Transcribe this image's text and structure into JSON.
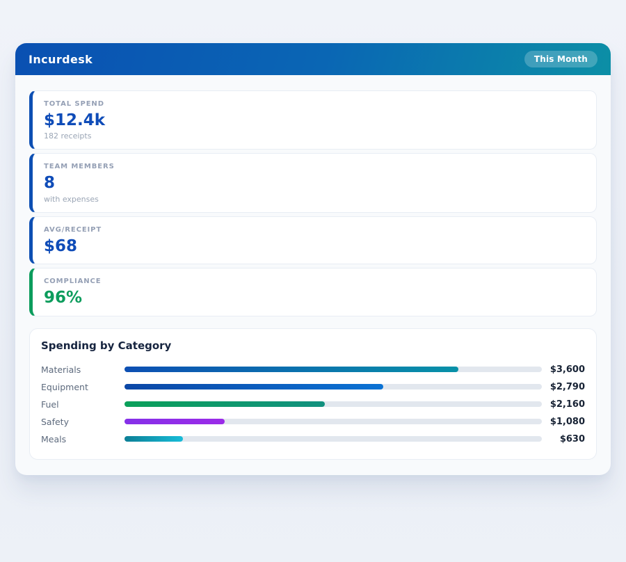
{
  "header": {
    "brand": "Incurdesk",
    "badge": "This Month"
  },
  "stats": [
    {
      "label": "TOTAL SPEND",
      "value": "$12.4k",
      "sub": "182 receipts",
      "accent_color": "#0d4fb3",
      "value_color": "#0f4cb8"
    },
    {
      "label": "TEAM MEMBERS",
      "value": "8",
      "sub": "with expenses",
      "accent_color": "#0d4fb3",
      "value_color": "#0f4cb8"
    },
    {
      "label": "AVG/RECEIPT",
      "value": "$68",
      "sub": "",
      "accent_color": "#0d4fb3",
      "value_color": "#0f4cb8"
    },
    {
      "label": "COMPLIANCE",
      "value": "96%",
      "sub": "",
      "accent_color": "#0c9c5c",
      "value_color": "#0c9c5c"
    }
  ],
  "chart": {
    "title": "Spending by Category"
  },
  "chart_data": {
    "type": "bar",
    "orientation": "horizontal",
    "title": "Spending by Category",
    "categories": [
      "Materials",
      "Equipment",
      "Fuel",
      "Safety",
      "Meals"
    ],
    "values": [
      3600,
      2790,
      2160,
      1080,
      630
    ],
    "value_labels": [
      "$3,600",
      "$2,790",
      "$2,160",
      "$1,080",
      "$630"
    ],
    "xlim": [
      0,
      4500
    ],
    "grid": false,
    "legend": false,
    "track_color": "#e2e7ee",
    "bar_gradients": [
      [
        "#0d4fb3",
        "#0891a8"
      ],
      [
        "#0c47a6",
        "#0b72d4"
      ],
      [
        "#0ba05a",
        "#12917f"
      ],
      [
        "#8530e8",
        "#9b2be8"
      ],
      [
        "#0c7f96",
        "#18bcd8"
      ]
    ]
  }
}
